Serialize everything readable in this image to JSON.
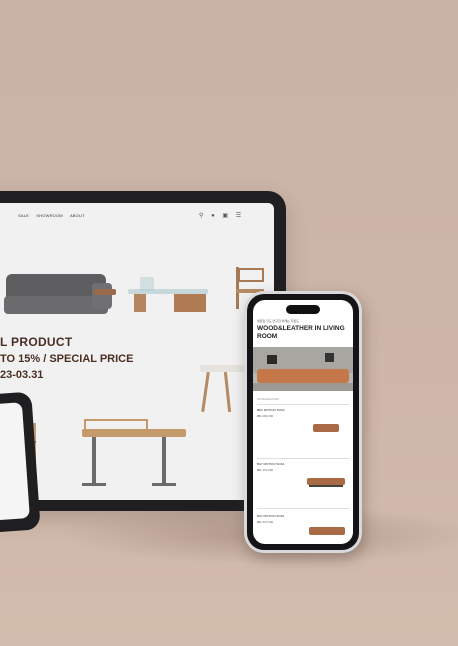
{
  "tablet": {
    "nav": [
      "SALE",
      "SHOWROOM",
      "ABOUT"
    ],
    "icons": [
      "search-icon",
      "user-icon",
      "cart-icon",
      "menu-icon"
    ],
    "promo": {
      "line1": "L PRODUCT",
      "line2": "TO 15% / SPECIAL PRICE",
      "line3": "23-03.31"
    }
  },
  "phone": {
    "subtitle": "영원장 힐도 연구한 하래는 자판도",
    "title": "WOOD&LEATHER IN LIVING ROOM",
    "section_label": "WOOD&LEATHER",
    "products": [
      {
        "name": "BEX MOTION SOFA",
        "price": "₩1,299,000"
      },
      {
        "name": "BAY MOTION SOFA",
        "price": "₩1,170,000"
      },
      {
        "name": "BAY MOTION SOFA",
        "price": "₩1,070,000"
      }
    ]
  },
  "colors": {
    "background": "#c9b4a6",
    "brand_text": "#4a2e25",
    "device_frame": "#1f1f21",
    "leather": "#a96b45"
  }
}
